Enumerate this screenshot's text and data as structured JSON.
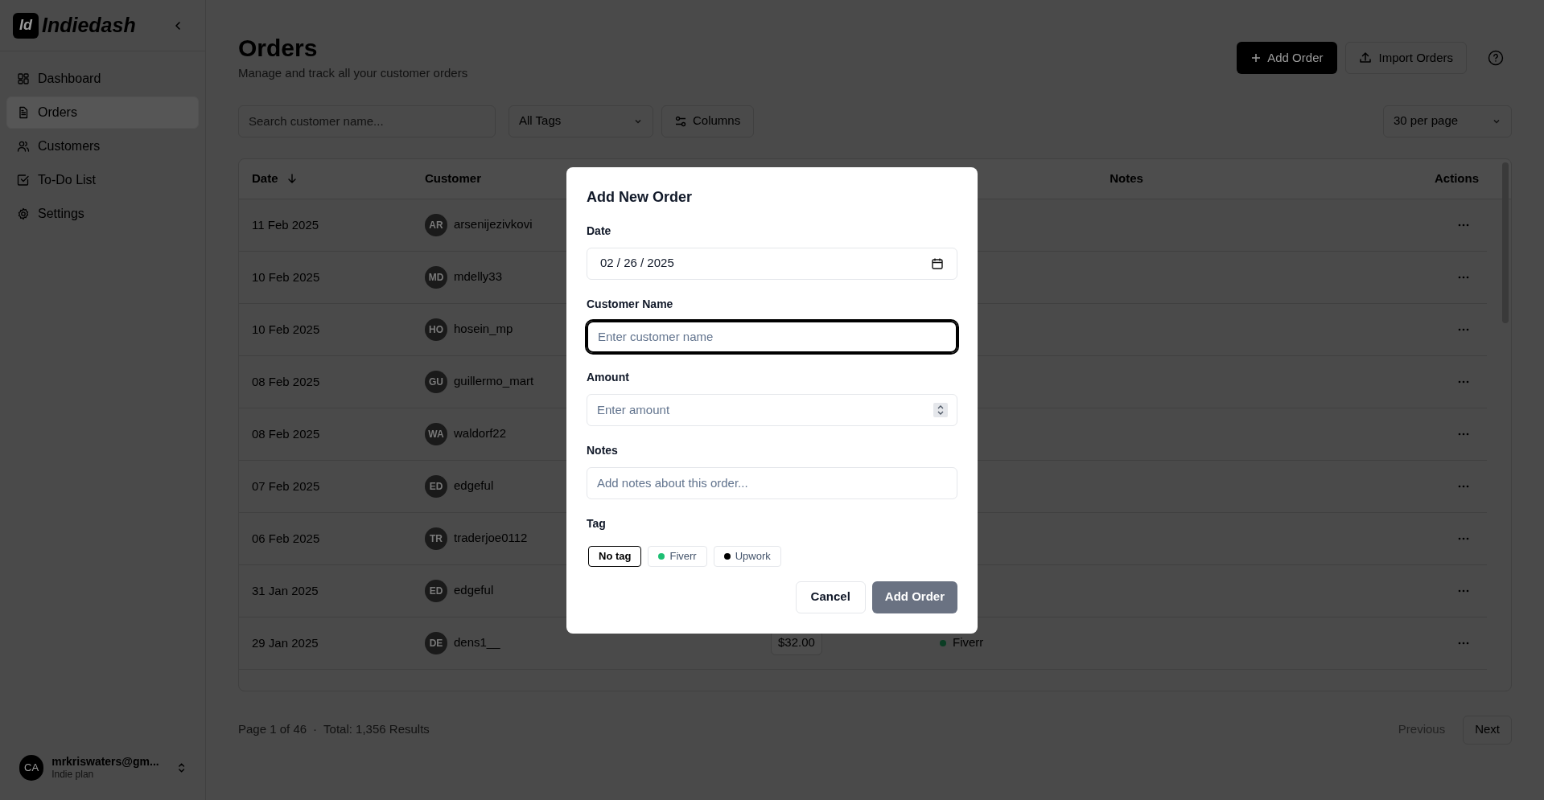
{
  "sidebar": {
    "logo_mark": "Id",
    "brand": "Indiedash",
    "items": [
      {
        "label": "Dashboard",
        "selected": false
      },
      {
        "label": "Orders",
        "selected": true
      },
      {
        "label": "Customers",
        "selected": false
      },
      {
        "label": "To-Do List",
        "selected": false
      },
      {
        "label": "Settings",
        "selected": false
      }
    ],
    "user": {
      "initials": "CA",
      "email": "mrkriswaters@gm...",
      "plan": "Indie plan"
    }
  },
  "header": {
    "title": "Orders",
    "subtitle": "Manage and track all your customer orders",
    "primary_button": "Add Order",
    "secondary_button": "Import Orders"
  },
  "toolbar": {
    "search_placeholder": "Search customer name...",
    "tag_filter": "All Tags",
    "columns_button": "Columns",
    "per_page": "30 per page"
  },
  "table": {
    "columns": [
      {
        "label": "Date",
        "sorted": true
      },
      {
        "label": "Customer",
        "sorted": false
      },
      {
        "label": "Notes",
        "sorted": false
      },
      {
        "label": "Actions",
        "sorted": false
      }
    ],
    "rows": [
      {
        "date": "11 Feb 2025",
        "initials": "AR",
        "customer": "arsenijezivkovi"
      },
      {
        "date": "10 Feb 2025",
        "initials": "MD",
        "customer": "mdelly33"
      },
      {
        "date": "10 Feb 2025",
        "initials": "HO",
        "customer": "hosein_mp"
      },
      {
        "date": "08 Feb 2025",
        "initials": "GU",
        "customer": "guillermo_mart"
      },
      {
        "date": "08 Feb 2025",
        "initials": "WA",
        "customer": "waldorf22"
      },
      {
        "date": "07 Feb 2025",
        "initials": "ED",
        "customer": "edgeful"
      },
      {
        "date": "06 Feb 2025",
        "initials": "TR",
        "customer": "traderjoe0112"
      },
      {
        "date": "31 Jan 2025",
        "initials": "ED",
        "customer": "edgeful"
      },
      {
        "date": "29 Jan 2025",
        "initials": "DE",
        "customer": "dens1__",
        "amount": "$32.00",
        "tag": {
          "label": "Fiverr",
          "color": "#0b3d24"
        }
      }
    ]
  },
  "footer": {
    "page": "Page 1 of 46",
    "separator": "·",
    "total": "Total: 1,356 Results",
    "previous": {
      "label": "Previous",
      "disabled": true
    },
    "next": {
      "label": "Next",
      "disabled": false
    }
  },
  "modal": {
    "title": "Add New Order",
    "fields": [
      {
        "kind": "date",
        "label": "Date",
        "value": "02 / 26 / 2025",
        "focused": false
      },
      {
        "kind": "text",
        "label": "Customer Name",
        "placeholder": "Enter customer name",
        "focused": true
      },
      {
        "kind": "number",
        "label": "Amount",
        "placeholder": "Enter amount",
        "focused": false
      },
      {
        "kind": "text",
        "label": "Notes",
        "placeholder": "Add notes about this order...",
        "focused": false
      }
    ],
    "tag_label": "Tag",
    "tags": [
      {
        "label": "No tag",
        "selected": true
      },
      {
        "label": "Fiverr",
        "color": "#1dbf73",
        "selected": false
      },
      {
        "label": "Upwork",
        "color": "#000000",
        "selected": false
      }
    ],
    "cancel": "Cancel",
    "submit": {
      "label": "Add Order",
      "disabled": true
    }
  }
}
